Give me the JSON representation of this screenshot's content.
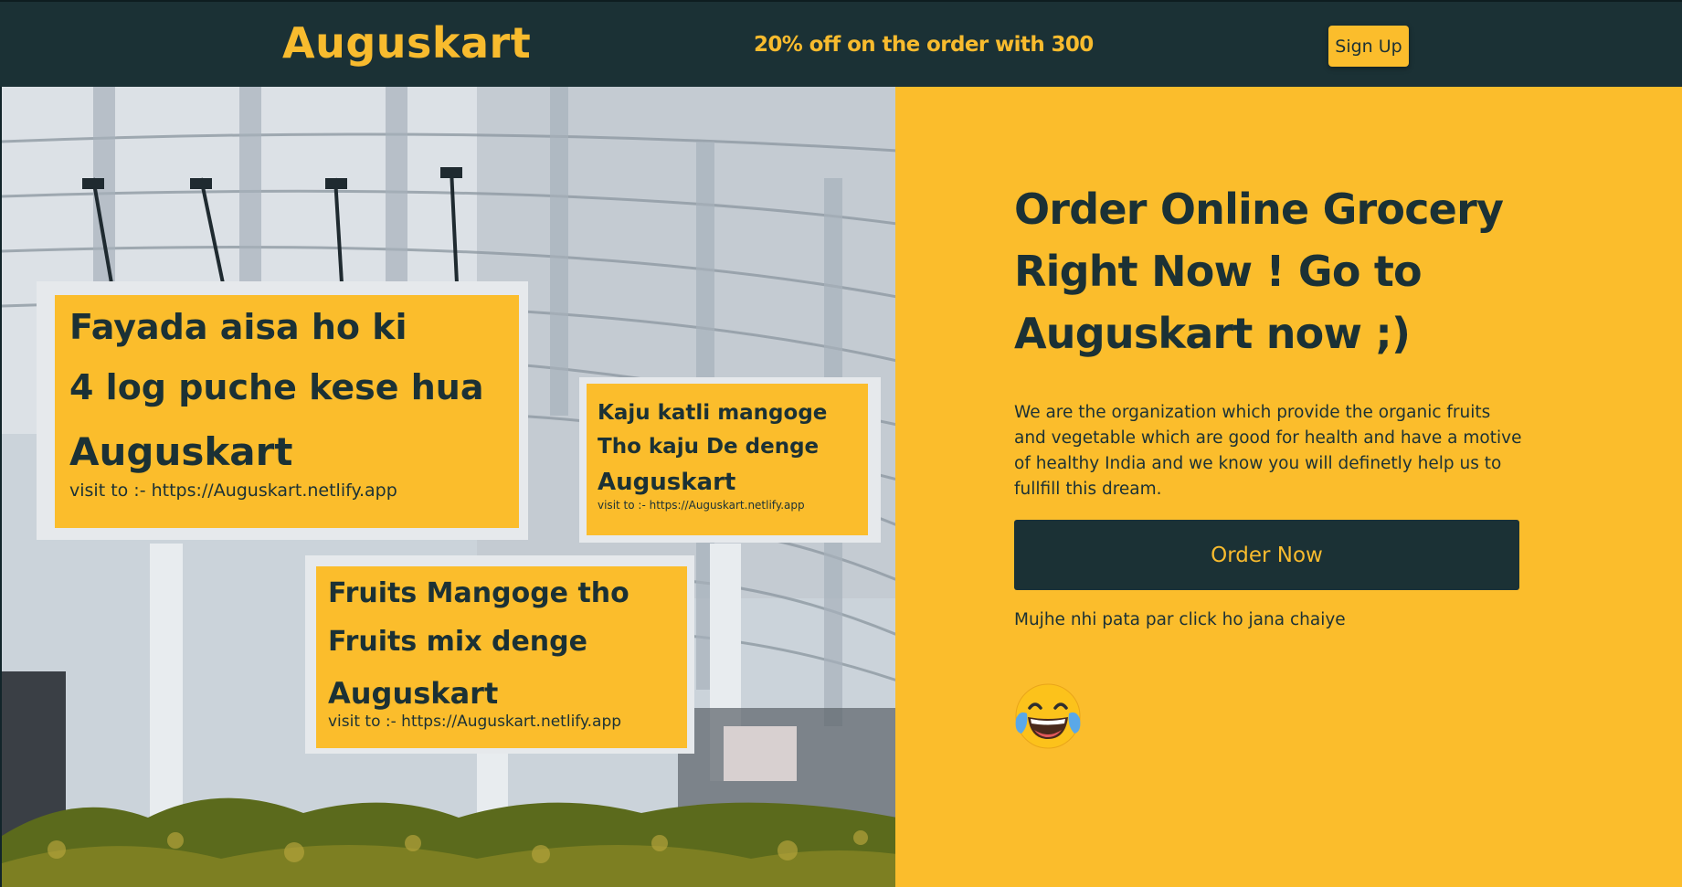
{
  "header": {
    "logo": "Auguskart",
    "offer": "20% off on the order with 300",
    "signup_label": "Sign Up"
  },
  "hero_image": {
    "billboard1": {
      "line1": "Fayada aisa ho ki",
      "line2": "4 log puche kese hua",
      "brand": "Auguskart",
      "url": "visit to :- https://Auguskart.netlify.app"
    },
    "billboard2": {
      "line1": "Kaju katli mangoge",
      "line2": "Tho kaju De denge",
      "brand": "Auguskart",
      "url": "visit to :- https://Auguskart.netlify.app"
    },
    "billboard3": {
      "line1": "Fruits Mangoge tho",
      "line2": "Fruits mix denge",
      "brand": "Auguskart",
      "url": "visit to :- https://Auguskart.netlify.app"
    }
  },
  "main": {
    "headline_line1": "Order Online Grocery",
    "headline_line2": "Right Now ! Go to",
    "headline_line3": "Auguskart now ;)",
    "description": "We are the organization which provide the organic fruits and vegetable which are good for health and have a motive of healthy India and we know you will definetly help us to fullfill this dream.",
    "order_label": "Order Now",
    "note": "Mujhe nhi pata par click ho jana chaiye",
    "emoji_icon": "face-with-tears-of-joy-icon"
  },
  "colors": {
    "dark": "#1b3135",
    "accent": "#fbbd2c"
  }
}
